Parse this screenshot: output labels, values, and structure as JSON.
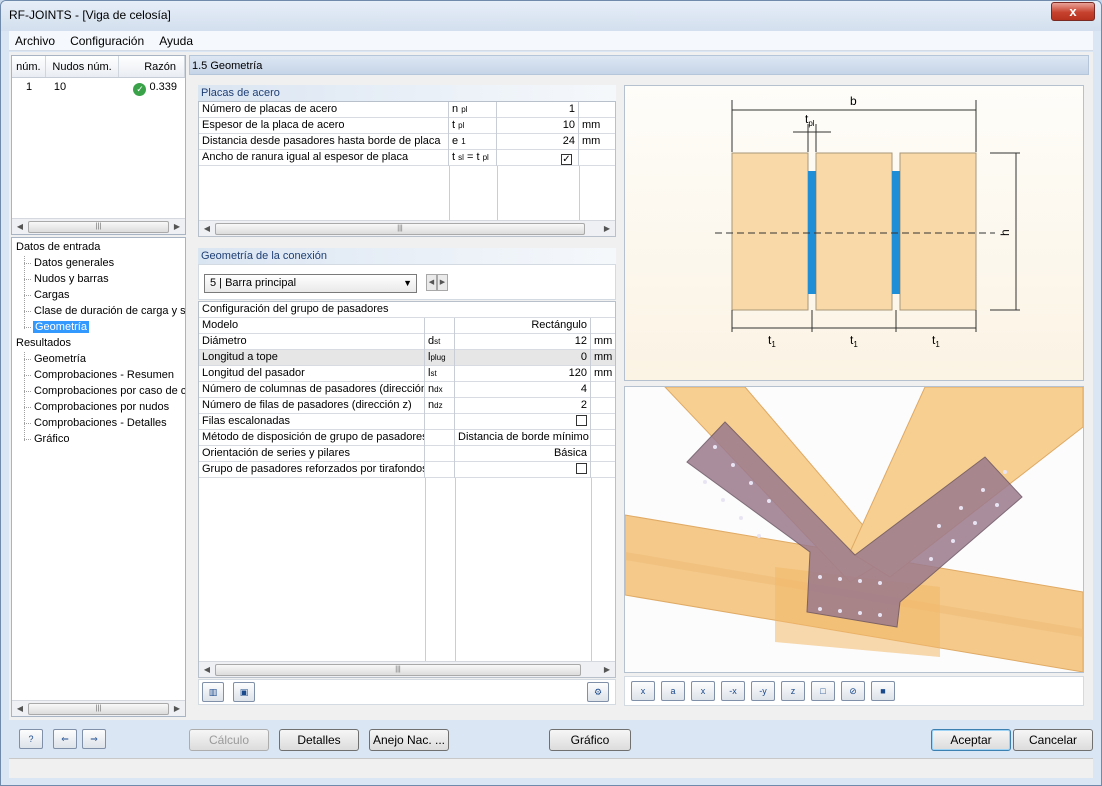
{
  "window": {
    "title": "RF-JOINTS - [Viga de celosía]",
    "close_label": "x"
  },
  "menu": [
    "Archivo",
    "Configuración",
    "Ayuda"
  ],
  "results_table": {
    "headers": [
      "núm.",
      "Nudos núm.",
      "Razón"
    ],
    "rows": [
      {
        "num": "1",
        "nodes": "10",
        "ratio": "0.339"
      }
    ]
  },
  "tree": {
    "input_heading": "Datos de entrada",
    "input_items": [
      "Datos generales",
      "Nudos y barras",
      "Cargas",
      "Clase de duración de carga y s",
      "Geometría"
    ],
    "results_heading": "Resultados",
    "result_items": [
      "Geometría",
      "Comprobaciones - Resumen",
      "Comprobaciones por caso de ca",
      "Comprobaciones por nudos",
      "Comprobaciones - Detalles",
      "Gráfico"
    ],
    "selected": "Geometría"
  },
  "section_title": "1.5 Geometría",
  "plates": {
    "label": "Placas de acero",
    "rows": [
      {
        "name": "Número de placas de acero",
        "sym": "n",
        "sub": "pl",
        "value": "1",
        "unit": ""
      },
      {
        "name": "Espesor de la placa de acero",
        "sym": "t",
        "sub": "pl",
        "value": "10",
        "unit": "mm"
      },
      {
        "name": "Distancia desde pasadores hasta borde de placa",
        "sym": "e",
        "sub": "1",
        "value": "24",
        "unit": "mm"
      },
      {
        "name": "Ancho de ranura igual al espesor de placa",
        "sym": "t",
        "sub": "sl",
        "sym2": " = t",
        "sub2": "pl",
        "checked": true
      }
    ]
  },
  "connection": {
    "label": "Geometría de la conexión",
    "member_select": "5 | Barra principal",
    "rows": [
      {
        "name": "Configuración del grupo de pasadores",
        "sym": "",
        "sub": "",
        "value": "",
        "unit": "",
        "header": true
      },
      {
        "name": "Modelo",
        "sym": "",
        "sub": "",
        "value": "Rectángulo",
        "unit": ""
      },
      {
        "name": "Diámetro",
        "sym": "d",
        "sub": "st",
        "value": "12",
        "unit": "mm"
      },
      {
        "name": "Longitud a tope",
        "sym": "l",
        "sub": "plug",
        "value": "0",
        "unit": "mm",
        "shaded": true
      },
      {
        "name": "Longitud del pasador",
        "sym": "l",
        "sub": "st",
        "value": "120",
        "unit": "mm"
      },
      {
        "name": "Número de columnas de pasadores (dirección",
        "sym": "n",
        "sub": "dx",
        "value": "4",
        "unit": ""
      },
      {
        "name": "Número de filas de pasadores (dirección z)",
        "sym": "n",
        "sub": "dz",
        "value": "2",
        "unit": ""
      },
      {
        "name": "Filas escalonadas",
        "sym": "",
        "sub": "",
        "checkbox": false
      },
      {
        "name": "Método de disposición de grupo de pasadores",
        "sym": "",
        "sub": "",
        "value": "Distancia de borde mínimo",
        "unit": ""
      },
      {
        "name": "Orientación de series y pilares",
        "sym": "",
        "sub": "",
        "value": "Básica",
        "unit": ""
      },
      {
        "name": "Grupo de pasadores reforzados por tirafondos",
        "sym": "",
        "sub": "",
        "checkbox": false
      }
    ]
  },
  "diagram": {
    "b": "b",
    "tpl": "t",
    "tpl_sub": "pl",
    "h": "h",
    "t1": "t",
    "t1_sub": "1"
  },
  "view_toolbar": [
    "x",
    "a",
    "x",
    "-x",
    "-y",
    "z",
    "□",
    "⊘",
    "■"
  ],
  "buttons": {
    "calc": "Cálculo",
    "details": "Detalles",
    "annex": "Anejo Nac. ...",
    "graphic": "Gráfico",
    "ok": "Aceptar",
    "cancel": "Cancelar"
  },
  "colors": {
    "accent": "#3399ff",
    "wood": "#f8d7a8",
    "plate": "#1f8ed6",
    "ok": "#3aa34a"
  }
}
